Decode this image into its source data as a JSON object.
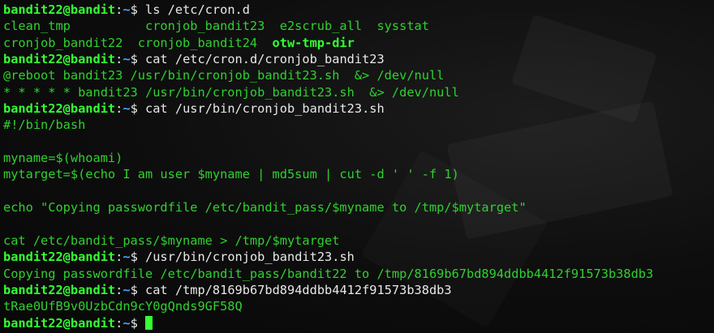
{
  "prompt": {
    "user": "bandit22@bandit",
    "sep": ":",
    "path": "~",
    "sigil": "$ "
  },
  "lines": [
    {
      "kind": "cmd",
      "text": "ls /etc/cron.d"
    },
    {
      "kind": "out",
      "text": "clean_tmp          cronjob_bandit23  e2scrub_all  sysstat"
    },
    {
      "kind": "out_mixed",
      "text": "cronjob_bandit22  cronjob_bandit24  ",
      "bold": "otw-tmp-dir"
    },
    {
      "kind": "cmd",
      "text": "cat /etc/cron.d/cronjob_bandit23"
    },
    {
      "kind": "out",
      "text": "@reboot bandit23 /usr/bin/cronjob_bandit23.sh  &> /dev/null"
    },
    {
      "kind": "out",
      "text": "* * * * * bandit23 /usr/bin/cronjob_bandit23.sh  &> /dev/null"
    },
    {
      "kind": "cmd",
      "text": "cat /usr/bin/cronjob_bandit23.sh"
    },
    {
      "kind": "out",
      "text": "#!/bin/bash"
    },
    {
      "kind": "out",
      "text": ""
    },
    {
      "kind": "out",
      "text": "myname=$(whoami)"
    },
    {
      "kind": "out",
      "text": "mytarget=$(echo I am user $myname | md5sum | cut -d ' ' -f 1)"
    },
    {
      "kind": "out",
      "text": ""
    },
    {
      "kind": "out",
      "text": "echo \"Copying passwordfile /etc/bandit_pass/$myname to /tmp/$mytarget\""
    },
    {
      "kind": "out",
      "text": ""
    },
    {
      "kind": "out",
      "text": "cat /etc/bandit_pass/$myname > /tmp/$mytarget"
    },
    {
      "kind": "cmd",
      "text": "/usr/bin/cronjob_bandit23.sh"
    },
    {
      "kind": "out",
      "text": "Copying passwordfile /etc/bandit_pass/bandit22 to /tmp/8169b67bd894ddbb4412f91573b38db3"
    },
    {
      "kind": "cmd",
      "text": "cat /tmp/8169b67bd894ddbb4412f91573b38db3"
    },
    {
      "kind": "out",
      "text": "tRae0UfB9v0UzbCdn9cY0gQnds9GF58Q"
    },
    {
      "kind": "cmd",
      "text": ""
    }
  ],
  "colors": {
    "user": "#33ff33",
    "path": "#4aa3ff",
    "command": "#e8e8e8",
    "output": "#2fd12f",
    "background": "#0b0b0b"
  }
}
